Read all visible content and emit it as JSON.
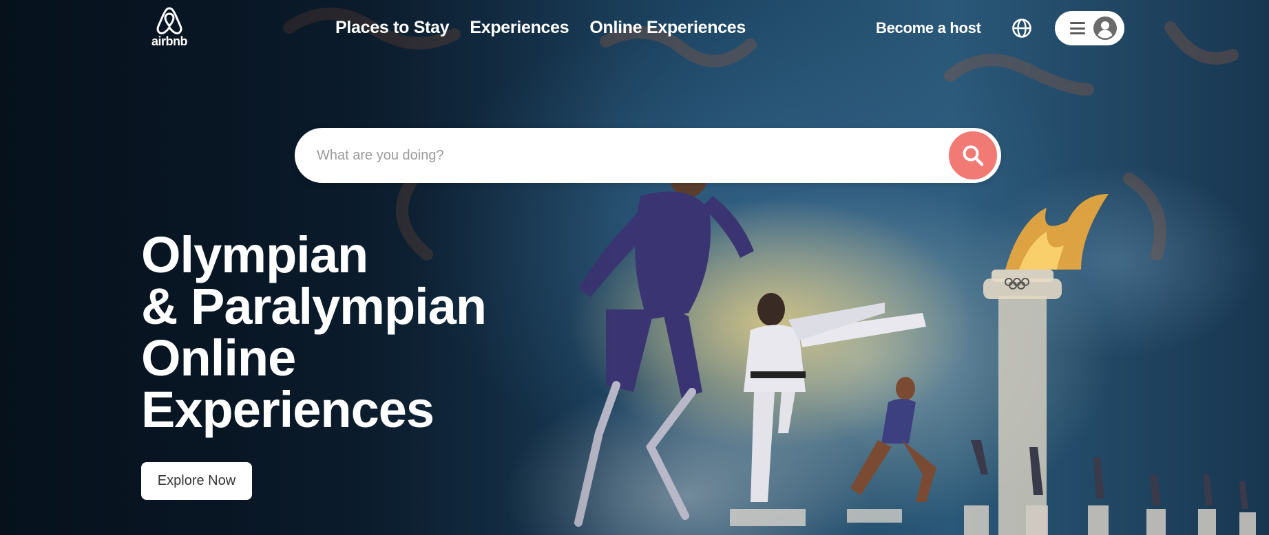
{
  "brand": {
    "name": "airbnb",
    "icon": "airbnb-logo-icon"
  },
  "nav": {
    "links": [
      "Places to Stay",
      "Experiences",
      "Online Experiences"
    ],
    "host_label": "Become a host",
    "globe_icon": "globe-icon",
    "menu_icon": "hamburger-menu-icon",
    "avatar_icon": "user-avatar-icon"
  },
  "search": {
    "placeholder": "What are you doing?",
    "button_icon": "search-icon",
    "button_color": "#f27a74"
  },
  "hero": {
    "headline_lines": [
      "Olympian",
      "& Paralympian",
      "Online",
      "Experiences"
    ],
    "cta_label": "Explore Now"
  }
}
